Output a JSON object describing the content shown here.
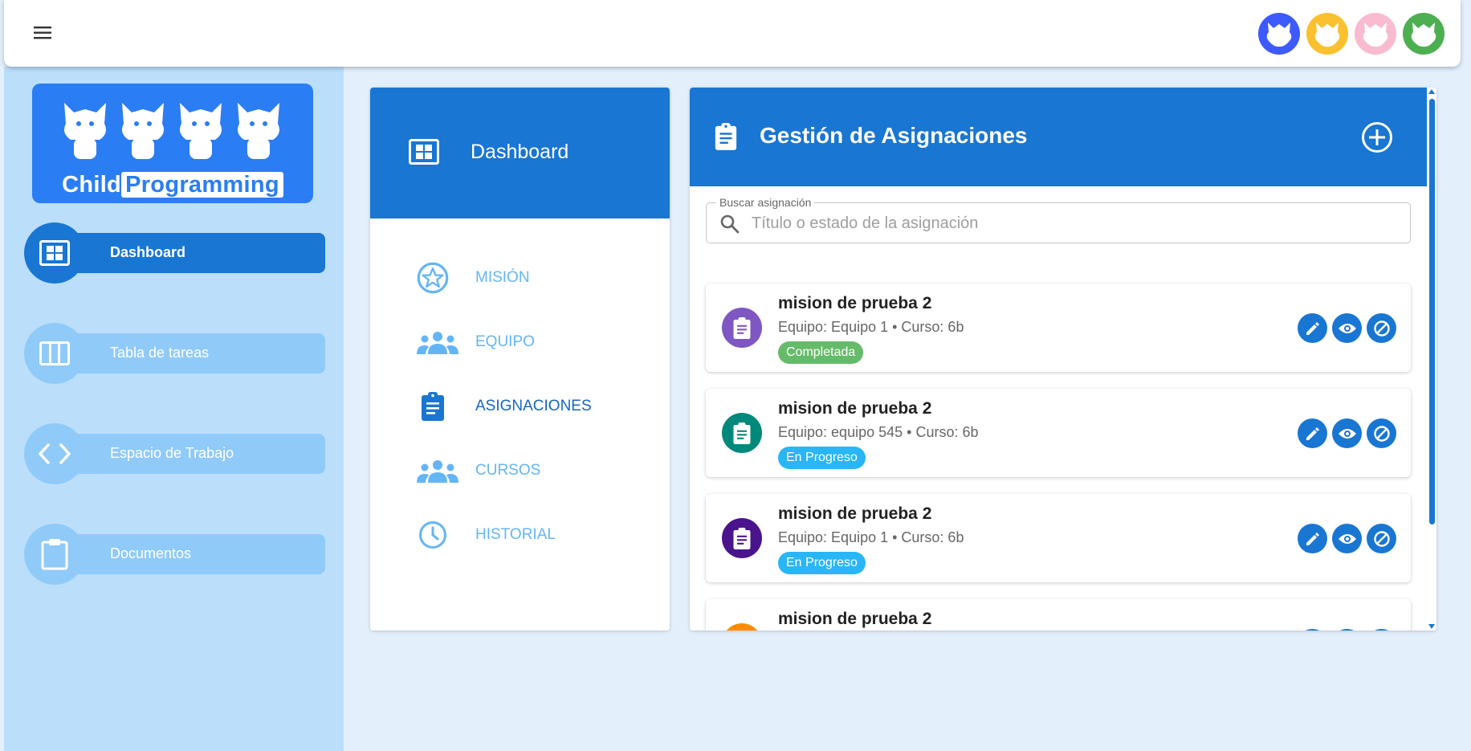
{
  "logo": {
    "word1": "Child",
    "word2": "Programming"
  },
  "avatars": [
    {
      "color": "#3d5afe"
    },
    {
      "color": "#fbc02d"
    },
    {
      "color": "#f8bbd0"
    },
    {
      "color": "#4caf50"
    }
  ],
  "sidebar": {
    "items": [
      {
        "label": "Dashboard",
        "icon": "dashboard-icon",
        "active": true
      },
      {
        "label": "Tabla de tareas",
        "icon": "columns-icon"
      },
      {
        "label": "Espacio de Trabajo",
        "icon": "code-icon"
      },
      {
        "label": "Documentos",
        "icon": "clipboard-icon"
      }
    ]
  },
  "mid": {
    "title": "Dashboard",
    "items": [
      {
        "label": "MISIÓN",
        "icon": "star-icon"
      },
      {
        "label": "EQUIPO",
        "icon": "group-icon"
      },
      {
        "label": "ASIGNACIONES",
        "icon": "assignment-icon",
        "active": true
      },
      {
        "label": "CURSOS",
        "icon": "group-icon"
      },
      {
        "label": "HISTORIAL",
        "icon": "clock-icon"
      }
    ]
  },
  "main": {
    "title": "Gestión de Asignaciones",
    "search": {
      "label": "Buscar asignación",
      "placeholder": "Título o estado de la asignación",
      "value": ""
    },
    "cards": [
      {
        "title": "mision de prueba 2",
        "subtitle": "Equipo: Equipo 1 • Curso: 6b",
        "status": "Completada",
        "status_color": "#66bb6a",
        "avatar_color": "#7e57c2"
      },
      {
        "title": "mision de prueba 2",
        "subtitle": "Equipo: equipo 545 • Curso: 6b",
        "status": "En Progreso",
        "status_color": "#29b6f6",
        "avatar_color": "#00897b"
      },
      {
        "title": "mision de prueba 2",
        "subtitle": "Equipo: Equipo 1 • Curso: 6b",
        "status": "En Progreso",
        "status_color": "#29b6f6",
        "avatar_color": "#4a148c"
      },
      {
        "title": "mision de prueba 2",
        "subtitle": "",
        "status": "",
        "status_color": "#29b6f6",
        "avatar_color": "#fb8c00"
      }
    ]
  },
  "colors": {
    "primary": "#1976d2",
    "sidebar_bg": "#bbdefb",
    "page_bg": "#e3f0fc",
    "light_accent": "#64b5f6"
  }
}
